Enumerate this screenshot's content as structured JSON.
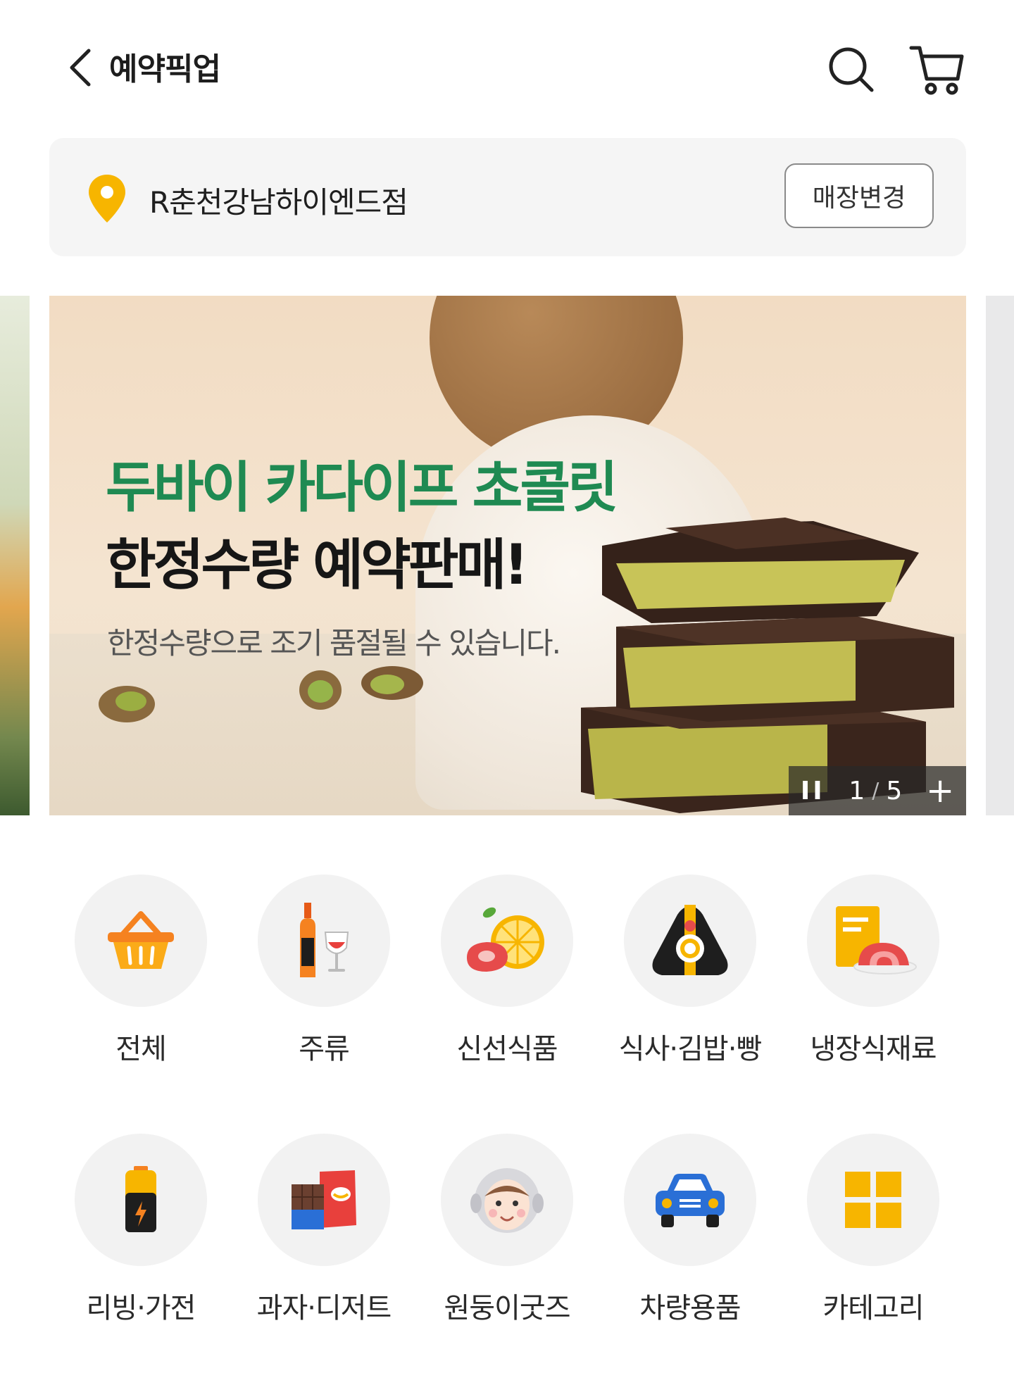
{
  "header": {
    "title": "예약픽업"
  },
  "store": {
    "name": "R춘천강남하이엔드점",
    "change_label": "매장변경"
  },
  "banner": {
    "headline1": "두바이 카다이프 초콜릿",
    "headline2": "한정수량 예약판매!",
    "subtext": "한정수량으로 조기 품절될 수 있습니다.",
    "current_page": "1",
    "separator": "/",
    "total_pages": "5",
    "pause_symbol": "II",
    "more_symbol": "+"
  },
  "categories": [
    {
      "label": "전체",
      "icon": "basket-icon"
    },
    {
      "label": "주류",
      "icon": "liquor-icon"
    },
    {
      "label": "신선식품",
      "icon": "fresh-food-icon"
    },
    {
      "label": "식사·김밥·빵",
      "icon": "rice-ball-icon"
    },
    {
      "label": "냉장식재료",
      "icon": "chilled-food-icon"
    },
    {
      "label": "리빙·가전",
      "icon": "battery-icon"
    },
    {
      "label": "과자·디저트",
      "icon": "snack-icon"
    },
    {
      "label": "원둥이굿즈",
      "icon": "monkey-goods-icon"
    },
    {
      "label": "차량용품",
      "icon": "car-icon"
    },
    {
      "label": "카테고리",
      "icon": "category-grid-icon"
    }
  ],
  "colors": {
    "accent": "#f7b500",
    "headline_green": "#1f8a52",
    "icon_orange": "#f58220"
  }
}
